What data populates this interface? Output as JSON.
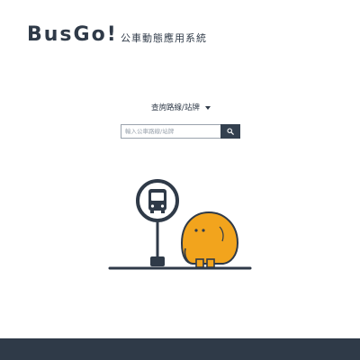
{
  "header": {
    "brand": "BusGo!",
    "subtitle": "公車動態應用系統"
  },
  "search": {
    "mode_label": "查詢路線/站牌",
    "placeholder": "輸入公車路線/站牌",
    "value": ""
  },
  "colors": {
    "primary": "#2f3a48",
    "accent": "#f2a41d",
    "background": "#ffffff"
  },
  "icons": {
    "search_button": "search-icon",
    "mode_dropdown": "caret-down-icon"
  }
}
